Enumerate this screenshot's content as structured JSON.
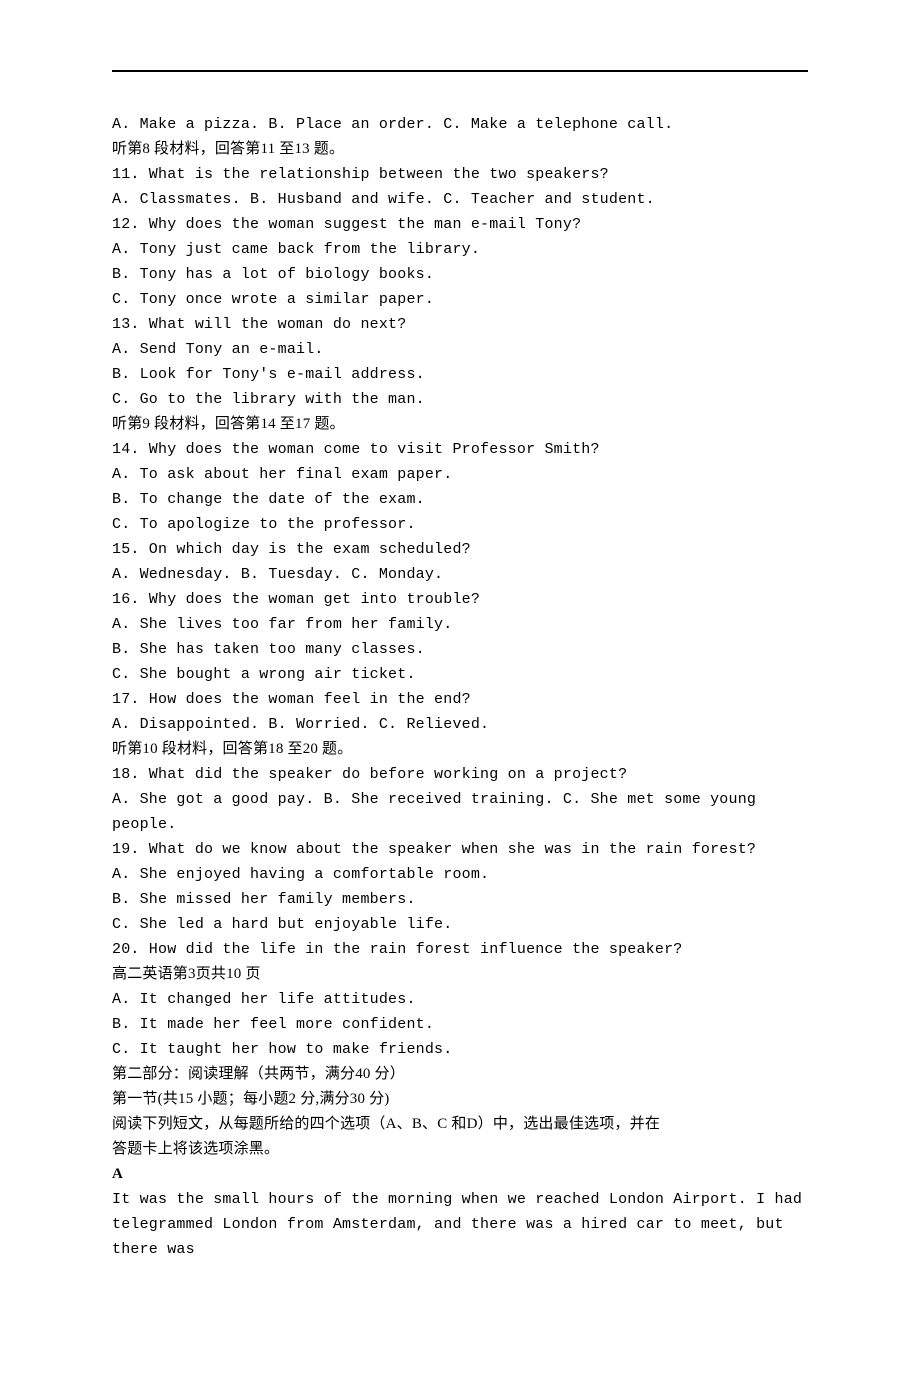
{
  "lines": [
    {
      "text": "A. Make a pizza. B. Place an order. C. Make a telephone call.",
      "cls": ""
    },
    {
      "text": "听第8 段材料，回答第11 至13 题。",
      "cls": "cn"
    },
    {
      "text": "11. What is the relationship between the two speakers?",
      "cls": ""
    },
    {
      "text": "A. Classmates. B. Husband and wife. C. Teacher and student.",
      "cls": ""
    },
    {
      "text": "12. Why does the woman suggest the man e-mail Tony?",
      "cls": ""
    },
    {
      "text": "A. Tony just came back from the library.",
      "cls": ""
    },
    {
      "text": "B. Tony has a lot of biology books.",
      "cls": ""
    },
    {
      "text": "C. Tony once wrote a similar paper.",
      "cls": ""
    },
    {
      "text": "13. What will the woman do next?",
      "cls": ""
    },
    {
      "text": "A. Send Tony an e-mail.",
      "cls": ""
    },
    {
      "text": "B. Look for Tony's e-mail address.",
      "cls": ""
    },
    {
      "text": "C. Go to the library with the man.",
      "cls": ""
    },
    {
      "text": "听第9 段材料，回答第14 至17 题。",
      "cls": "cn"
    },
    {
      "text": "14. Why does the woman come to visit Professor Smith?",
      "cls": ""
    },
    {
      "text": "A. To ask about her final exam paper.",
      "cls": ""
    },
    {
      "text": "B. To change the date of the exam.",
      "cls": ""
    },
    {
      "text": "C. To apologize to the professor.",
      "cls": ""
    },
    {
      "text": "15. On which day is the exam scheduled?",
      "cls": ""
    },
    {
      "text": "A. Wednesday. B. Tuesday. C. Monday.",
      "cls": ""
    },
    {
      "text": "16. Why does the woman get into trouble?",
      "cls": ""
    },
    {
      "text": "A. She lives too far from her family.",
      "cls": ""
    },
    {
      "text": "B. She has taken too many classes.",
      "cls": ""
    },
    {
      "text": "C. She bought a wrong air ticket.",
      "cls": ""
    },
    {
      "text": "17. How does the woman feel in the end?",
      "cls": ""
    },
    {
      "text": "A. Disappointed. B. Worried. C. Relieved.",
      "cls": ""
    },
    {
      "text": "听第10 段材料，回答第18 至20 题。",
      "cls": "cn"
    },
    {
      "text": "18. What did the speaker do before working on a project?",
      "cls": ""
    },
    {
      "text": "A. She got a good pay. B. She received training. C. She met some young people.",
      "cls": ""
    },
    {
      "text": "19. What do we know about the speaker when she was in the rain forest?",
      "cls": ""
    },
    {
      "text": "A. She enjoyed having a comfortable room.",
      "cls": ""
    },
    {
      "text": "B. She missed her family members.",
      "cls": ""
    },
    {
      "text": "C. She led a hard but enjoyable life.",
      "cls": ""
    },
    {
      "text": "20. How did the life in the rain forest influence the speaker?",
      "cls": ""
    },
    {
      "text": "高二英语第3页共10 页",
      "cls": "cn"
    },
    {
      "text": "A. It changed her life attitudes.",
      "cls": ""
    },
    {
      "text": "B. It made her feel more confident.",
      "cls": ""
    },
    {
      "text": "C. It taught her how to make friends.",
      "cls": ""
    },
    {
      "text": "第二部分：阅读理解（共两节，满分40 分）",
      "cls": "cn"
    },
    {
      "text": "第一节(共15 小题；每小题2 分,满分30 分)",
      "cls": "cn"
    },
    {
      "text": "阅读下列短文，从每题所给的四个选项（A、B、C 和D）中，选出最佳选项，并在",
      "cls": "cn"
    },
    {
      "text": "答题卡上将该选项涂黑。",
      "cls": "cn"
    },
    {
      "text": "A",
      "cls": "cn bold"
    },
    {
      "text": "It was the small hours of the morning when we reached London Airport. I had",
      "cls": ""
    },
    {
      "text": "telegrammed London from Amsterdam, and there was a hired car to meet, but there was",
      "cls": ""
    }
  ]
}
